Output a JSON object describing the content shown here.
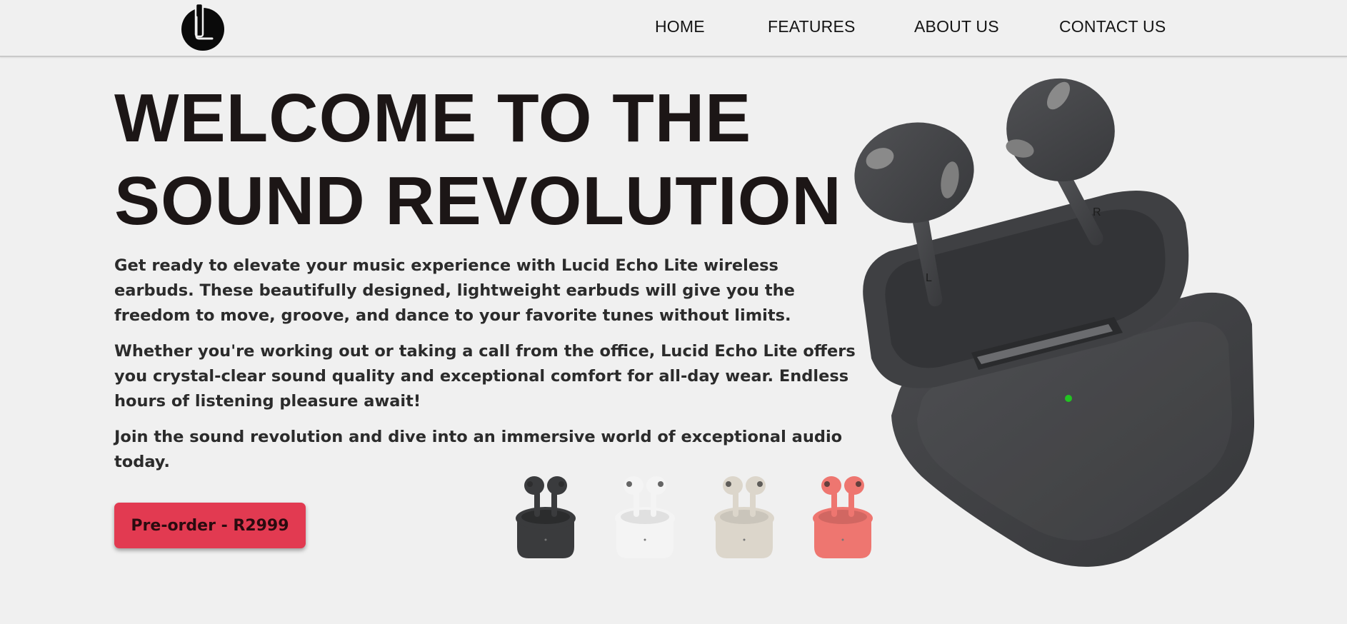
{
  "nav": {
    "logo": "logo-icon",
    "links": [
      "HOME",
      "FEATURES",
      "ABOUT US",
      "CONTACT US"
    ]
  },
  "hero": {
    "title_line1": "WELCOME TO THE",
    "title_line2": "SOUND REVOLUTION",
    "paragraph1": "Get ready to elevate your music experience with Lucid Echo Lite wireless earbuds. These beautifully designed, lightweight earbuds will give you the freedom to move, groove, and dance to your favorite tunes without limits.",
    "paragraph2": "Whether you're working out or taking a call from the office, Lucid Echo Lite offers you crystal-clear sound quality and exceptional comfort for all-day wear. Endless hours of listening pleasure await!",
    "paragraph3": "Join the sound revolution and dive into an immersive world of exceptional audio today.",
    "cta_label": "Pre-order - R2999"
  },
  "product": {
    "earbud_labels": {
      "left": "L",
      "right": "R"
    },
    "variants": [
      {
        "name": "black",
        "color": "#3a3b3d"
      },
      {
        "name": "white",
        "color": "#f4f4f4"
      },
      {
        "name": "beige",
        "color": "#dcd6cb"
      },
      {
        "name": "coral",
        "color": "#ee7670"
      }
    ],
    "status_light_color": "#22c322"
  },
  "colors": {
    "background": "#f0f0f0",
    "accent": "#e23a51",
    "text": "#1c1616"
  }
}
